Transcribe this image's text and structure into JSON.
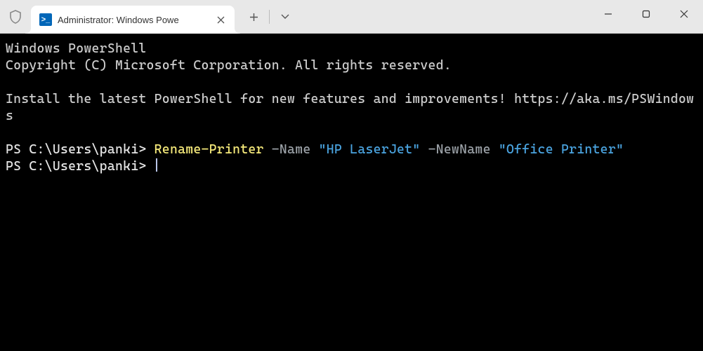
{
  "tab": {
    "title": "Administrator: Windows Powe"
  },
  "banner": {
    "line1": "Windows PowerShell",
    "line2": "Copyright (C) Microsoft Corporation. All rights reserved.",
    "line3": "Install the latest PowerShell for new features and improvements! https://aka.ms/PSWindows"
  },
  "cmd": {
    "prompt1": "PS C:\\Users\\panki> ",
    "cmdlet": "Rename-Printer",
    "sp1": " ",
    "param1": "-Name",
    "sp2": " ",
    "string1": "\"HP LaserJet\"",
    "sp3": " ",
    "param2": "-NewName",
    "sp4": " ",
    "string2": "\"Office Printer\"",
    "prompt2": "PS C:\\Users\\panki> "
  }
}
